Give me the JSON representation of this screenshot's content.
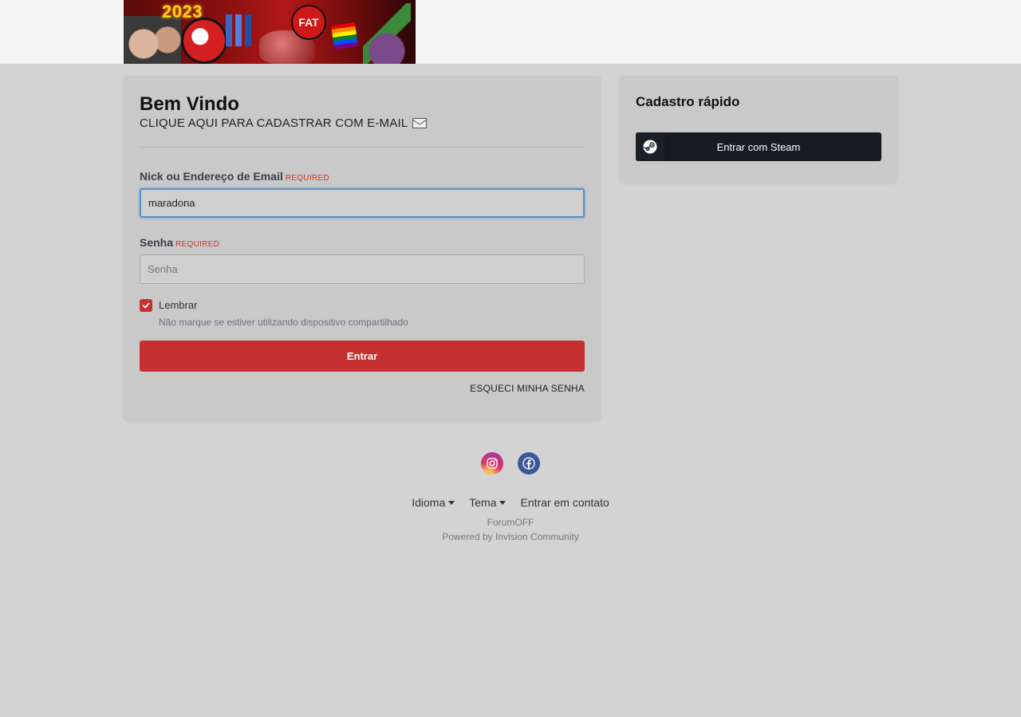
{
  "header": {
    "banner_year": "2023",
    "banner_badge": "FAT"
  },
  "login": {
    "title": "Bem Vindo",
    "register_link": "CLIQUE AQUI PARA CADASTRAR COM E-MAIL",
    "nick_label": "Nick ou Endereço de Email",
    "nick_required": "REQUIRED",
    "nick_value": "maradona",
    "senha_label": "Senha",
    "senha_required": "REQUIRED",
    "senha_placeholder": "Senha",
    "remember_label": "Lembrar",
    "remember_checked": true,
    "remember_hint": "Não marque se estiver utilizando dispositivo compartilhado",
    "submit_label": "Entrar",
    "forgot_label": "ESQUECI MINHA SENHA"
  },
  "quick": {
    "title": "Cadastro rápido",
    "steam_label": "Entrar com Steam"
  },
  "social": {
    "icons": [
      "instagram-icon",
      "facebook-icon"
    ]
  },
  "footer": {
    "language_label": "Idioma",
    "theme_label": "Tema",
    "contact_label": "Entrar em contato",
    "site_name": "ForumOFF",
    "powered_by": "Powered by Invision Community"
  },
  "colors": {
    "accent": "#c53030",
    "steam": "#171a21",
    "background": "#d3d3d3"
  }
}
